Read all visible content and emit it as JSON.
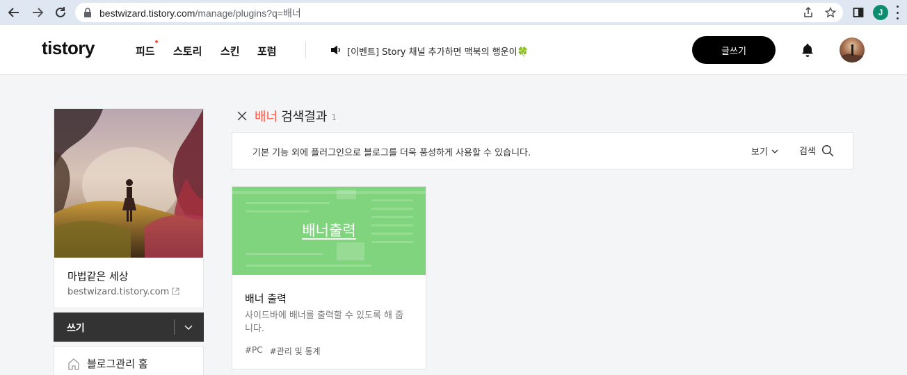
{
  "browser": {
    "url_host": "bestwizard.tistory.com",
    "url_path": "/manage/plugins?q=배너"
  },
  "header": {
    "logo": "tistory",
    "menu": [
      "피드",
      "스토리",
      "스킨",
      "포럼"
    ],
    "notice": "[이벤트] Story 채널 추가하면 맥북의 행운이",
    "notice_emoji": "🍀",
    "write_button": "글쓰기"
  },
  "profile_initial": "J",
  "sidebar": {
    "blog_title": "마법같은 세상",
    "blog_url": "bestwizard.tistory.com",
    "write_menu": "쓰기",
    "admin_home": "블로그관리 홈"
  },
  "search": {
    "query": "배너",
    "title": "검색결과",
    "count": "1"
  },
  "filter": {
    "description": "기본 기능 외에 플러그인으로 블로그를 더욱 풍성하게 사용할 수 있습니다.",
    "view_label": "보기",
    "search_label": "검색"
  },
  "plugins": [
    {
      "thumb_label": "배너출력",
      "name": "배너 출력",
      "description": "사이드바에 배너를 출력할 수 있도록 해 줍니다.",
      "tags": [
        "#PC",
        "#관리 및 통계"
      ]
    }
  ],
  "colors": {
    "accent": "#ff5544",
    "thumb_green": "#80d47e",
    "dark_button": "#000000"
  }
}
